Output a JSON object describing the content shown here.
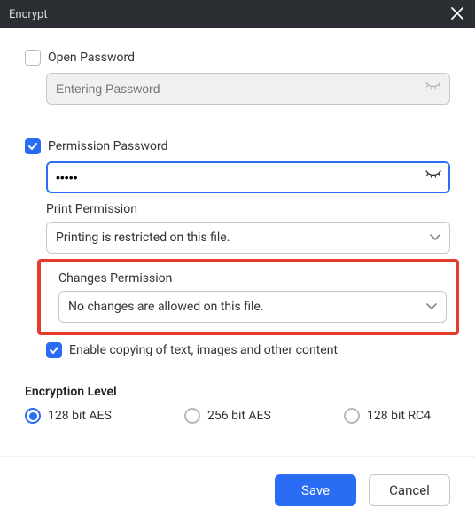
{
  "title": "Encrypt",
  "openPassword": {
    "checked": false,
    "label": "Open Password",
    "placeholder": "Entering Password",
    "value": ""
  },
  "permissionPassword": {
    "checked": true,
    "label": "Permission Password",
    "value": "•••••"
  },
  "printPermission": {
    "label": "Print Permission",
    "value": "Printing is restricted on this file."
  },
  "changesPermission": {
    "label": "Changes Permission",
    "value": "No changes are allowed on this file."
  },
  "enableCopy": {
    "checked": true,
    "label": "Enable copying of text, images and other content"
  },
  "encryptionLevel": {
    "label": "Encryption Level",
    "options": [
      "128 bit AES",
      "256 bit AES",
      "128 bit RC4"
    ],
    "selected": 0
  },
  "buttons": {
    "save": "Save",
    "cancel": "Cancel"
  }
}
